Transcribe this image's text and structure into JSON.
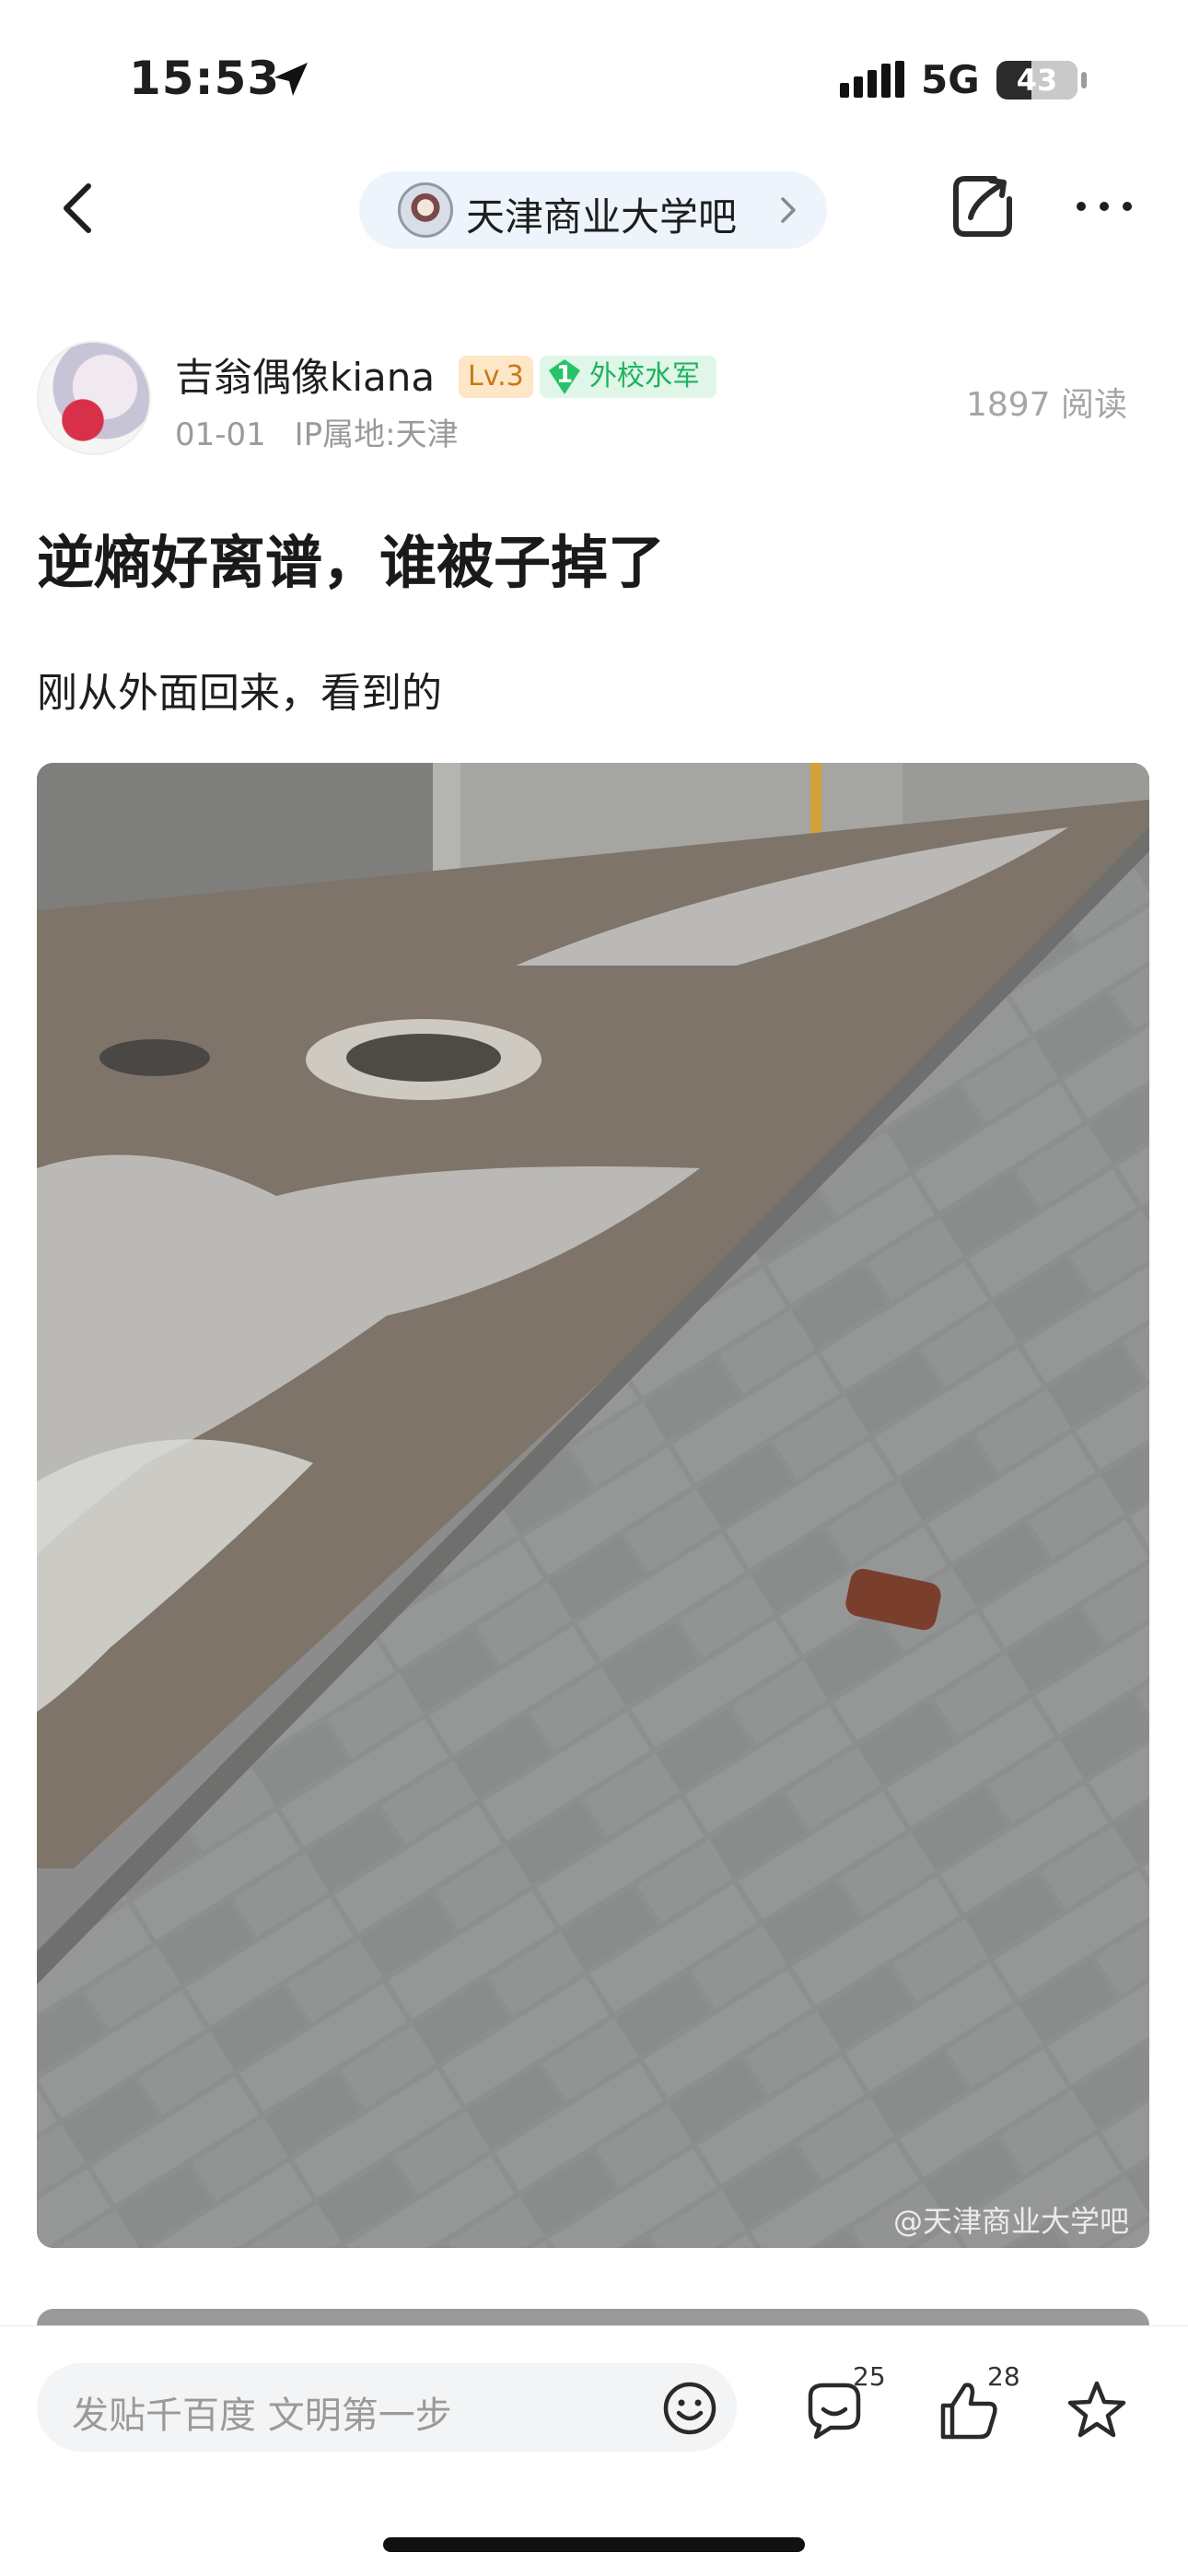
{
  "status_bar": {
    "time": "15:53",
    "network": "5G",
    "battery": "43",
    "battery_level": 0.43
  },
  "nav": {
    "forum_name": "天津商业大学吧"
  },
  "post": {
    "author": "吉翁偶像kiana",
    "level_badge": "Lv.3",
    "tag_level": "1",
    "tag_label": "外校水军",
    "date": "01-01",
    "ip_location": "IP属地:天津",
    "read_count": "1897 阅读",
    "title": "逆熵好离谱，谁被子掉了",
    "body": "刚从外面回来，看到的",
    "image_watermark": "@天津商业大学吧"
  },
  "bottom_bar": {
    "input_placeholder": "发贴千百度 文明第一步",
    "comment_count": "25",
    "like_count": "28"
  },
  "colors": {
    "accent_green": "#1fb25d",
    "level_orange": "#c47a1a",
    "pill_bg": "#eef4fb"
  },
  "icons": [
    "location-arrow-icon",
    "signal-icon",
    "back-icon",
    "chevron-right-icon",
    "share-icon",
    "more-icon",
    "emoji-icon",
    "comment-icon",
    "like-icon",
    "star-icon"
  ]
}
